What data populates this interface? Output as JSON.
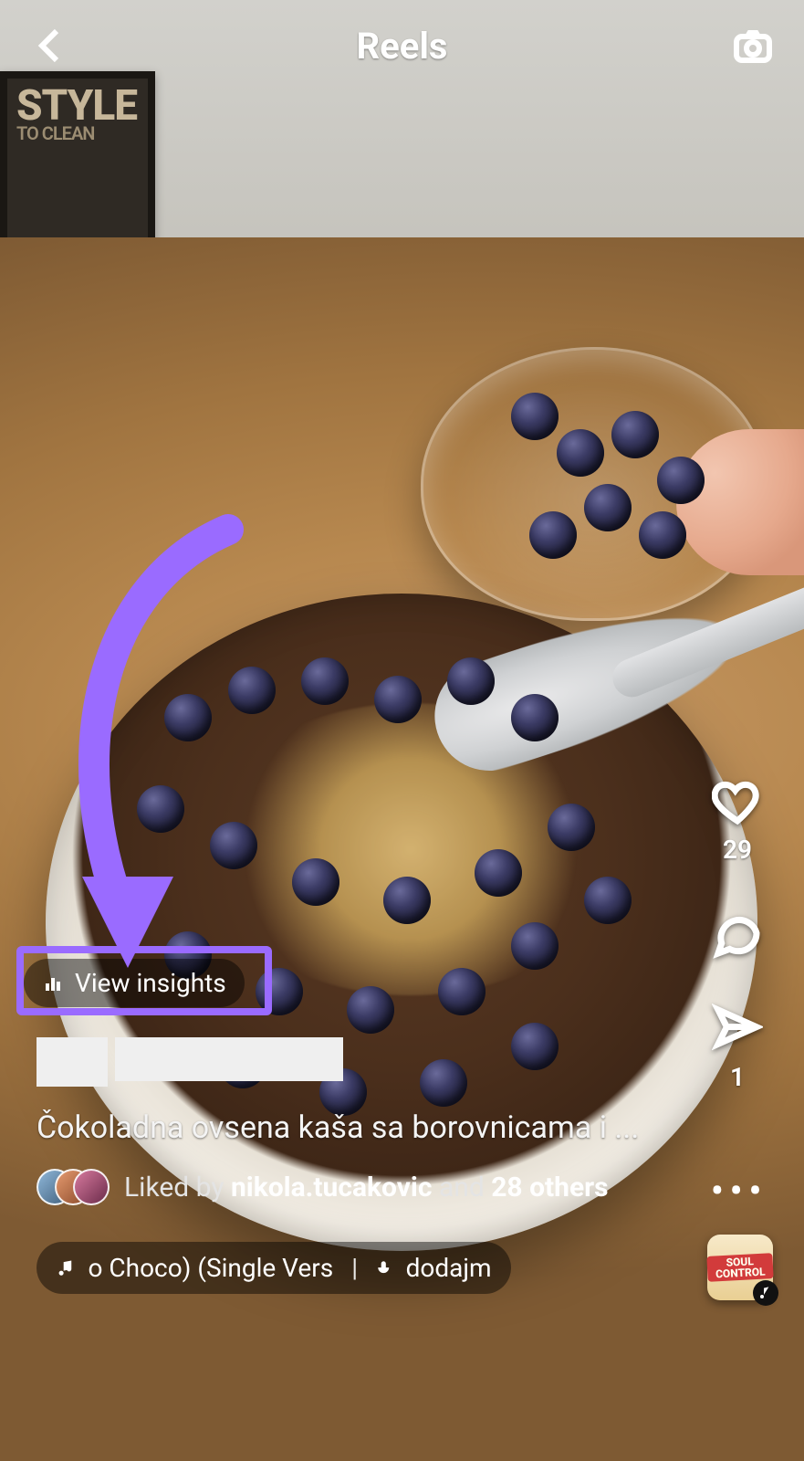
{
  "header": {
    "title": "Reels"
  },
  "rail": {
    "like_count": "29",
    "share_count": "1"
  },
  "insights": {
    "label": "View insights"
  },
  "caption": {
    "text": "Čokoladna ovsena kaša sa borovnicama i ..."
  },
  "liked": {
    "prefix": "Liked by ",
    "user": "nikola.tucakovic",
    "middle": " and ",
    "others": "28 others"
  },
  "audio": {
    "track_fragment": "o Choco) (Single Version)",
    "separator": "|",
    "username_fragment": "dodajma",
    "thumb_label": "SOUL CONTROL"
  },
  "frame_sign": {
    "line1": "STYLE",
    "line2": "TO CLEAN"
  },
  "colors": {
    "highlight": "#9a6bff"
  }
}
